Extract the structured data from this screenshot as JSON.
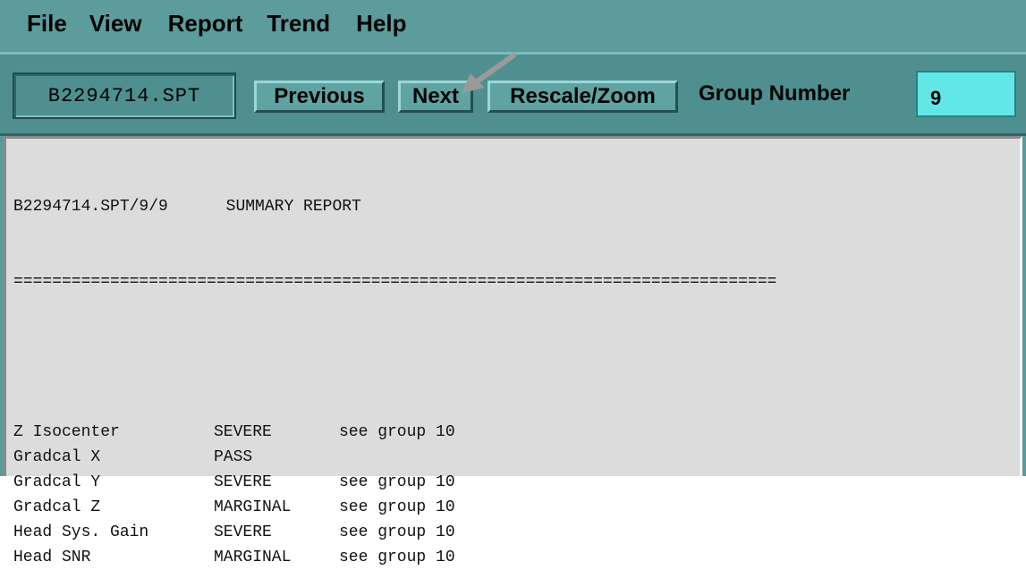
{
  "menu": {
    "items": [
      {
        "label": "File"
      },
      {
        "label": "View"
      },
      {
        "label": "Report"
      },
      {
        "label": "Trend"
      },
      {
        "label": "Help"
      }
    ]
  },
  "toolbar": {
    "filename": "B2294714.SPT",
    "previous_label": "Previous",
    "next_label": "Next",
    "rescale_label": "Rescale/Zoom",
    "group_number_label": "Group Number",
    "group_number_value": "9"
  },
  "report": {
    "header": "B2294714.SPT/9/9      SUMMARY REPORT",
    "separator": "===============================================================================",
    "rows": [
      {
        "name": "Z Isocenter",
        "status": "SEVERE",
        "note": "see group 10"
      },
      {
        "name": "Gradcal X",
        "status": "PASS",
        "note": ""
      },
      {
        "name": "Gradcal Y",
        "status": "SEVERE",
        "note": "see group 10"
      },
      {
        "name": "Gradcal Z",
        "status": "MARGINAL",
        "note": "see group 10"
      },
      {
        "name": "Head Sys. Gain",
        "status": "SEVERE",
        "note": "see group 10"
      },
      {
        "name": "Head SNR",
        "status": "MARGINAL",
        "note": "see group 10"
      }
    ]
  },
  "colors": {
    "menubar_bg": "#5d9c9c",
    "toolbar_bg": "#4f8f8f",
    "input_bg": "#62e6e6",
    "report_bg": "#dcdcdc",
    "arrow": "#9a9a9a"
  },
  "annotation": {
    "icon": "arrow-pointer-icon"
  }
}
